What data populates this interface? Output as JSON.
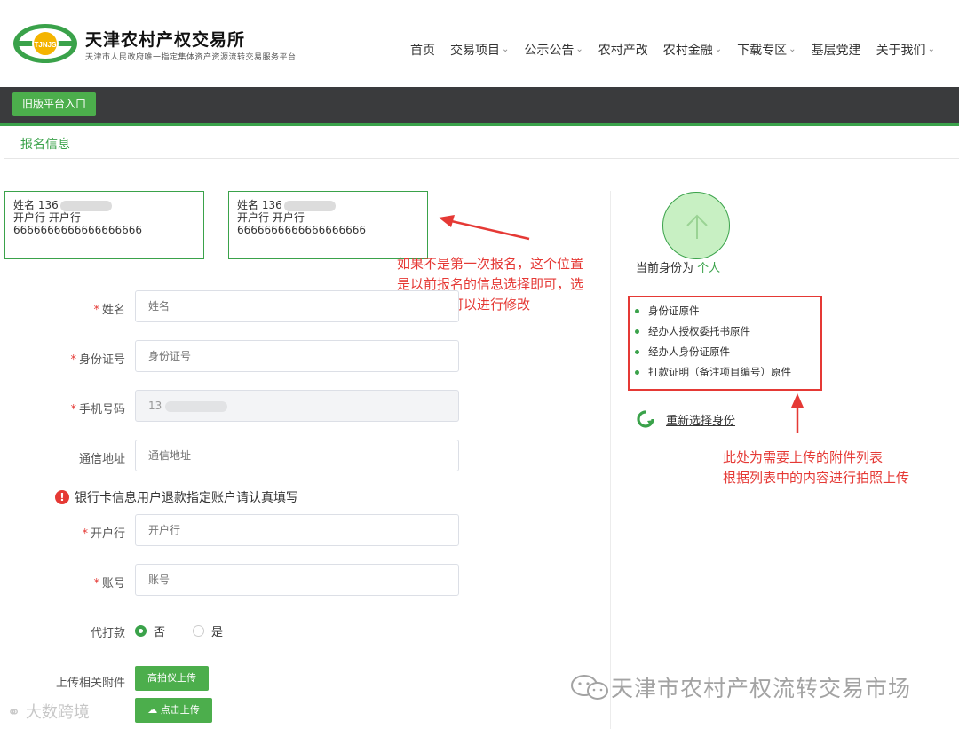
{
  "header": {
    "logo_text": "TJNJS",
    "title": "天津农村产权交易所",
    "subtitle": "天津市人民政府唯一指定集体资产资源流转交易服务平台",
    "nav": [
      {
        "label": "首页",
        "has_dropdown": false
      },
      {
        "label": "交易项目",
        "has_dropdown": true
      },
      {
        "label": "公示公告",
        "has_dropdown": true
      },
      {
        "label": "农村产改",
        "has_dropdown": false
      },
      {
        "label": "农村金融",
        "has_dropdown": true
      },
      {
        "label": "下载专区",
        "has_dropdown": true
      },
      {
        "label": "基层党建",
        "has_dropdown": false
      },
      {
        "label": "关于我们",
        "has_dropdown": true
      }
    ]
  },
  "toolbar": {
    "old_platform_label": "旧版平台入口"
  },
  "section": {
    "title": "报名信息"
  },
  "previous_cards": [
    {
      "name_line": "姓名 136",
      "bank_line": "开户行 开户行",
      "account_line": "6666666666666666666"
    },
    {
      "name_line": "姓名 136",
      "bank_line": "开户行 开户行",
      "account_line": "6666666666666666666"
    }
  ],
  "annotations": {
    "left_lines": [
      "如果不是第一次报名，这个位置",
      "是以前报名的信息选择即可，选",
      "择后信息可以进行修改"
    ],
    "right_lines": [
      "此处为需要上传的附件列表",
      "根据列表中的内容进行拍照上传"
    ]
  },
  "form": {
    "name": {
      "label": "姓名",
      "required": true,
      "placeholder": "姓名"
    },
    "id_number": {
      "label": "身份证号",
      "required": true,
      "placeholder": "身份证号"
    },
    "phone": {
      "label": "手机号码",
      "required": true,
      "value": "13"
    },
    "address": {
      "label": "通信地址",
      "required": false,
      "placeholder": "通信地址"
    },
    "bank_notice": "银行卡信息用户退款指定账户请认真填写",
    "bank": {
      "label": "开户行",
      "required": true,
      "placeholder": "开户行"
    },
    "account": {
      "label": "账号",
      "required": true,
      "placeholder": "账号"
    },
    "proxy_pay": {
      "label": "代打款",
      "options": [
        "否",
        "是"
      ],
      "selected": "否"
    },
    "upload": {
      "label": "上传相关附件",
      "scanner_button": "高拍仪上传",
      "click_button": "点击上传"
    }
  },
  "identity": {
    "prefix": "当前身份为",
    "value": "个人",
    "attachments": [
      "身份证原件",
      "经办人授权委托书原件",
      "经办人身份证原件",
      "打款证明（备注项目编号）原件"
    ],
    "reselect_label": "重新选择身份"
  },
  "watermark": {
    "main": "天津市农村产权流转交易市场",
    "corner": "大数跨境"
  },
  "colors": {
    "brand_green": "#3aa24a",
    "button_green": "#4cae4c",
    "dark_bar": "#3a3b3d",
    "annotation_red": "#e53935"
  }
}
